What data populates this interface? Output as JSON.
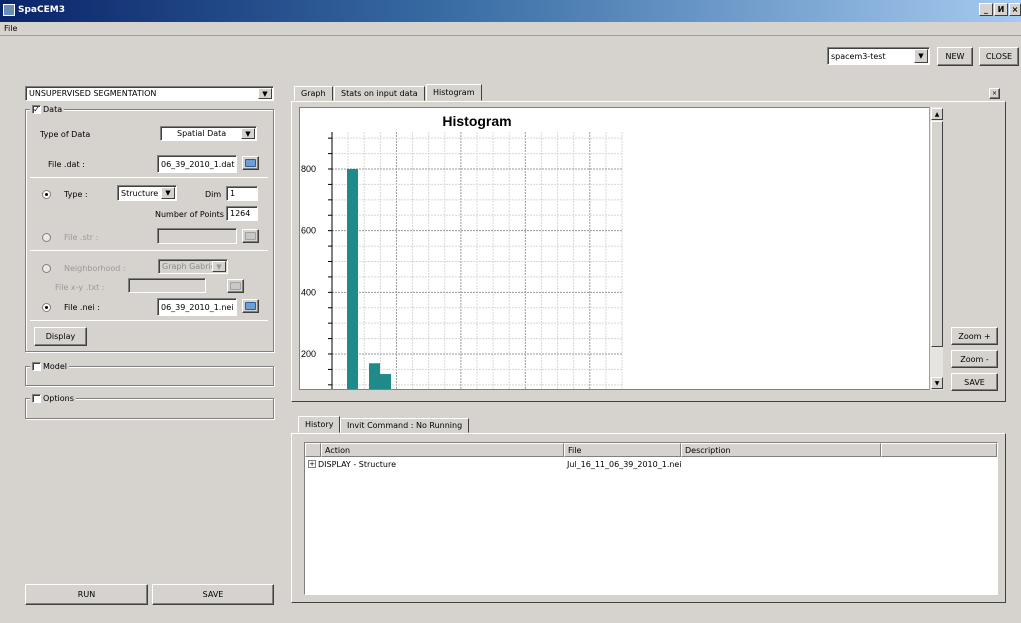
{
  "window": {
    "title": "SpaCEM3",
    "controls": {
      "minimize": "_",
      "maximize": "И",
      "close": "×"
    }
  },
  "menu": {
    "file": "File"
  },
  "topbar": {
    "project": "spacem3-test",
    "new_label": "NEW",
    "close_label": "CLOSE"
  },
  "left": {
    "method": "UNSUPERVISED SEGMENTATION",
    "data_group": {
      "title": "Data",
      "checked": true,
      "type_of_data_label": "Type of Data",
      "type_of_data_value": "Spatial Data",
      "file_dat_label": "File .dat :",
      "file_dat_value": "06_39_2010_1.dat",
      "type_label": "Type :",
      "type_value": "Structure",
      "dim_label": "Dim",
      "dim_value": "1",
      "num_points_label": "Number of Points",
      "num_points_value": "1264",
      "file_str_label": "File .str :",
      "file_str_value": "",
      "neighborhood_label": "Neighborhood :",
      "neighborhood_value": "Graph Gabriel",
      "file_xy_label": "File x-y .txt :",
      "file_xy_value": "",
      "file_nei_label": "File .nei :",
      "file_nei_value": "06_39_2010_1.nei",
      "display_label": "Display"
    },
    "model_group": {
      "title": "Model",
      "checked": false
    },
    "options_group": {
      "title": "Options",
      "checked": false
    },
    "run_label": "RUN",
    "save_label": "SAVE"
  },
  "graph_area": {
    "tabs": [
      "Graph",
      "Stats on input data",
      "Histogram"
    ],
    "active_tab": 2,
    "zoom_in_label": "Zoom +",
    "zoom_out_label": "Zoom -",
    "save_label": "SAVE"
  },
  "chart_data": {
    "type": "bar",
    "title": "Histogram",
    "y_ticks": [
      "800",
      "600",
      "400",
      "200"
    ],
    "ylim": [
      80,
      920
    ],
    "values": [
      800,
      0,
      170,
      135
    ],
    "grid": true,
    "bar_color": "#1f8a8a"
  },
  "bottom": {
    "tabs": [
      "History",
      "Invit Command : No Running"
    ],
    "active_tab": 0,
    "columns": [
      "Action",
      "File",
      "Description"
    ],
    "rows": [
      {
        "action": "DISPLAY - Structure",
        "file": "Jul_16_11_06_39_2010_1.nei",
        "description": ""
      }
    ]
  }
}
